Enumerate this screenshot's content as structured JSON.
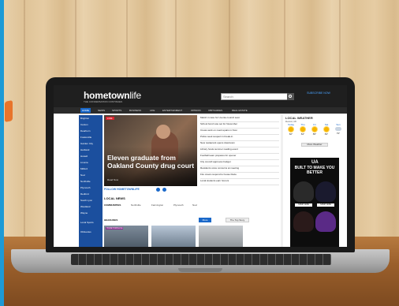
{
  "site": {
    "logo_main": "hometown",
    "logo_light": "life",
    "logo_sub": "THE CONVERSATION CONTINUES"
  },
  "search": {
    "placeholder": "Search"
  },
  "header": {
    "subscribe": "SUBSCRIBE NOW"
  },
  "nav": {
    "items": [
      "HOME",
      "NEWS",
      "SPORTS",
      "BUSINESS",
      "LIFE",
      "ENTERTAINMENT",
      "OPINION",
      "OBITUARIES",
      "REAL ESTATE"
    ]
  },
  "rail": {
    "items": [
      "Brighton",
      "Canton",
      "Dearborn",
      "Fowlerville",
      "Garden City",
      "Hartland",
      "Howell",
      "Livonia",
      "Milford",
      "Novi",
      "Northville",
      "Plymouth",
      "Redford",
      "South Lyon",
      "Westland",
      "Wayne",
      "Local Sports",
      "Obituaries"
    ]
  },
  "hero": {
    "badge": "LIVE",
    "title": "Eleven graduate from Oakland County drug court",
    "meta": "Read Now"
  },
  "headlines": [
    "Marsh in race for Livonia council seat",
    "School bond vote set for November",
    "Crews work on road repairs in Novi",
    "Police seek suspect in break-in",
    "New restaurant opens downtown",
    "Library hosts summer reading event",
    "Football team prepares for opener",
    "City council approves budget",
    "Residents voice concerns at meeting",
    "Fire crews respond to house blaze",
    "Local students earn honors"
  ],
  "weather": {
    "title": "LOCAL WEATHER",
    "location": "Detroit, MI",
    "days": [
      {
        "name": "Today",
        "icon": "sun-icon",
        "temp": "82°"
      },
      {
        "name": "Thu",
        "icon": "sun-icon",
        "temp": "84°"
      },
      {
        "name": "Fri",
        "icon": "sun-icon",
        "temp": "85°"
      },
      {
        "name": "Sat",
        "icon": "sun-icon",
        "temp": "83°"
      },
      {
        "name": "Sun",
        "icon": "cloud-icon",
        "temp": "79°"
      }
    ],
    "more": "More Weather"
  },
  "ad": {
    "brand": "UA",
    "headline": "BUILT TO MAKE YOU BETTER",
    "buy": "SHOP NOW"
  },
  "follow": {
    "label": "FOLLOW HOMETOWNLIFE"
  },
  "local_news": {
    "title": "LOCAL NEWS",
    "communities": "COMMUNITIES",
    "labels": [
      "Northville",
      "Farmington",
      "Plymouth",
      "Novi"
    ],
    "headlines": "HEADLINES",
    "btn_more": "More",
    "btn_top": "The Top Story",
    "thumb_badge": "HOMETOWNLIFE"
  }
}
